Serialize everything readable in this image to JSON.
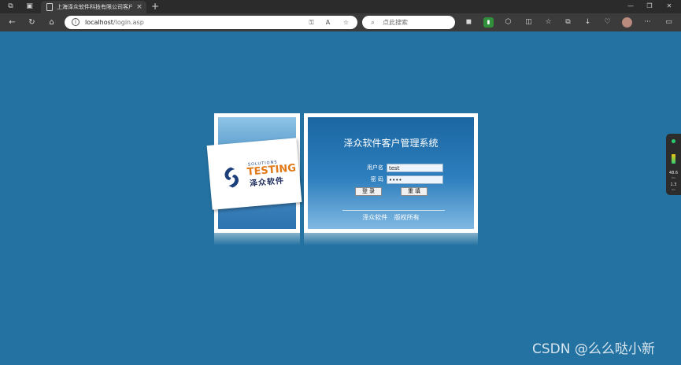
{
  "browser": {
    "tab_title": "上海泽众软件科技有限公司客户",
    "close_glyph": "×",
    "new_tab_glyph": "+",
    "url_host": "localhost",
    "url_path": "/login.asp",
    "search_placeholder": "点此搜索",
    "window_controls": [
      "—",
      "❐",
      "✕"
    ]
  },
  "logo": {
    "solutions": "SOLUTIONS",
    "testing": "TESTING",
    "company_cn": "泽众软件",
    "colors": {
      "orange": "#e07a19",
      "navy": "#1c3e7a"
    }
  },
  "login": {
    "title": "泽众软件客户管理系统",
    "username_label": "用户名",
    "username_value": "test",
    "password_label": "密  码",
    "password_value": "••••",
    "login_button": "登 录",
    "reset_button": "重 填",
    "copyright": "泽众软件 版权所有"
  },
  "side_widget": {
    "upload": "48.6",
    "upload_unit": "K/s",
    "download": "1.3",
    "download_unit": "K/s"
  },
  "watermark": "CSDN @么么哒小新",
  "colors": {
    "page_bg": "#2472a2",
    "panel_frame": "#ffffff",
    "chrome_dark": "#2b2b2b"
  }
}
